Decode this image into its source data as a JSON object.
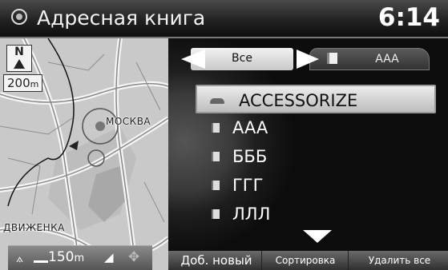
{
  "header": {
    "title": "Адресная книга",
    "clock": "6:14",
    "nav_icon": "navigation-icon"
  },
  "map": {
    "north_label": "N",
    "zoom_value": "200",
    "zoom_unit": "m",
    "place_moskva": "МОСКВА",
    "place_bottom": "ДВИЖЕНКА",
    "footer_scale_value": "150",
    "footer_scale_unit": "m"
  },
  "tabs": {
    "active": "Все",
    "next": "AAA"
  },
  "list": [
    {
      "label": "ACCESSORIZE",
      "icon": "car-icon",
      "selected": true
    },
    {
      "label": "AAA",
      "icon": "book-icon"
    },
    {
      "label": "БББ",
      "icon": "book-icon"
    },
    {
      "label": "ГГГ",
      "icon": "book-icon"
    },
    {
      "label": "ЛЛЛ",
      "icon": "book-icon"
    }
  ],
  "bottom": {
    "add_new": "Доб. новый",
    "sort": "Сортировка",
    "delete_all": "Удалить все"
  }
}
